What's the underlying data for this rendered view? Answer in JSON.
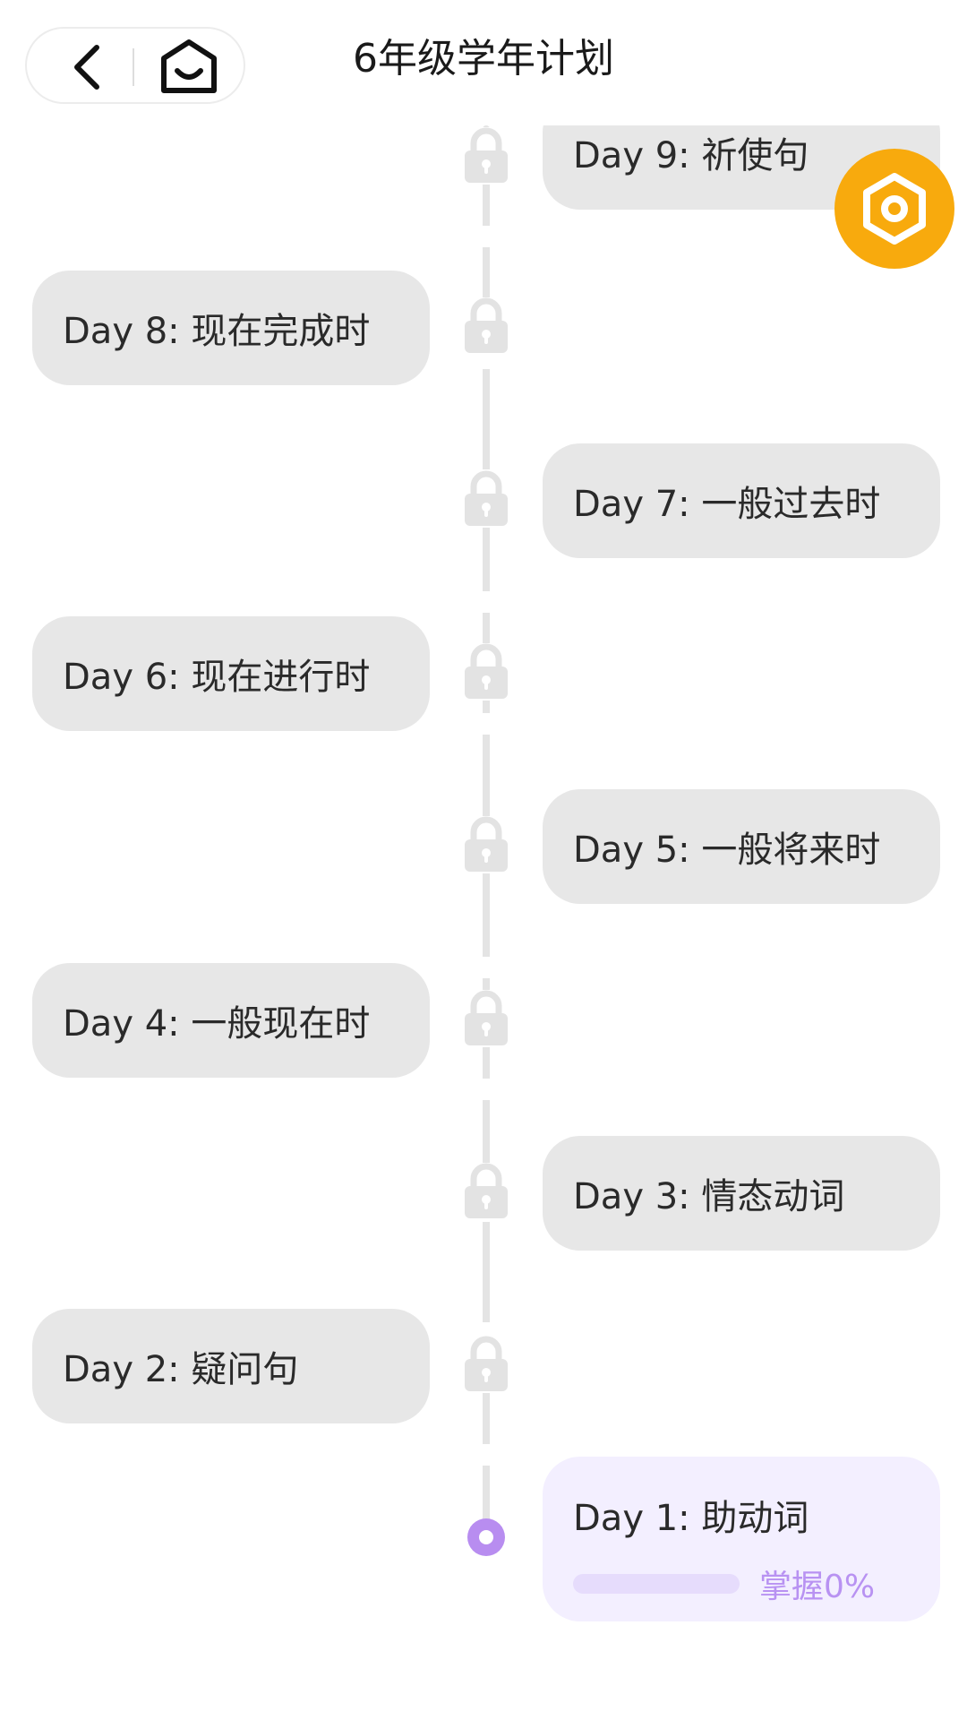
{
  "header": {
    "title": "6年级学年计划"
  },
  "lessons": [
    {
      "label": "Day 9: 祈使句",
      "locked": true
    },
    {
      "label": "Day 8: 现在完成时",
      "locked": true
    },
    {
      "label": "Day 7: 一般过去时",
      "locked": true
    },
    {
      "label": "Day 6: 现在进行时",
      "locked": true
    },
    {
      "label": "Day 5: 一般将来时",
      "locked": true
    },
    {
      "label": "Day 4: 一般现在时",
      "locked": true
    },
    {
      "label": "Day 3: 情态动词",
      "locked": true
    },
    {
      "label": "Day 2: 疑问句",
      "locked": true
    },
    {
      "label": "Day 1: 助动词",
      "locked": false,
      "progress_text": "掌握0%",
      "progress": 0
    }
  ],
  "colors": {
    "accent": "#b892f2",
    "fab": "#f8aa0d",
    "card": "#e7e7e7",
    "active_card": "#f3efff"
  },
  "icons": {
    "back": "chevron-left-icon",
    "home": "home-icon",
    "lock": "lock-icon",
    "settings": "settings-hexagon-icon"
  }
}
